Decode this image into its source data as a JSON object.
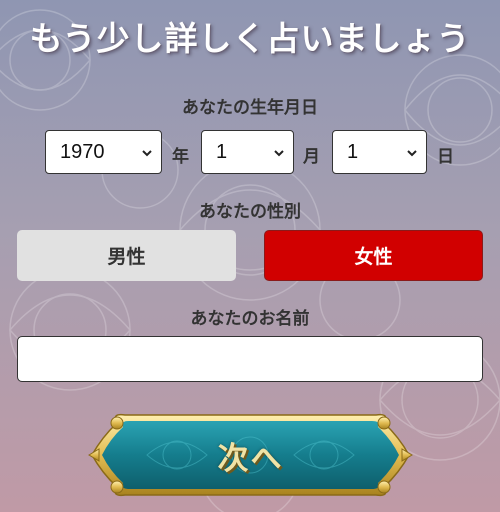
{
  "title": "もう少し詳しく占いましょう",
  "birthdate": {
    "label": "あなたの生年月日",
    "year": "1970",
    "year_unit": "年",
    "month": "1",
    "month_unit": "月",
    "day": "1",
    "day_unit": "日"
  },
  "gender": {
    "label": "あなたの性別",
    "male": "男性",
    "female": "女性",
    "selected": "女性"
  },
  "name": {
    "label": "あなたのお名前",
    "value": ""
  },
  "next_label": "次へ",
  "colors": {
    "selected_gender": "#d10000",
    "unselected_gender": "#e1e1e1",
    "button_teal": "#1e8e9e",
    "button_gold": "#e2bc52"
  },
  "icons": {
    "select_arrow": "chevron-down-icon"
  }
}
